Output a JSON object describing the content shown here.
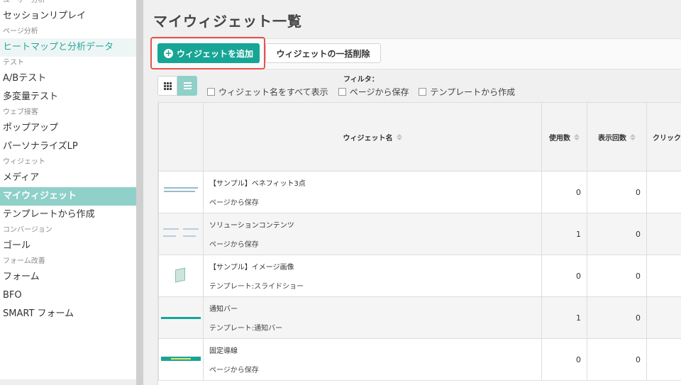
{
  "sidebar": {
    "groups": [
      {
        "heading": "ユーザー分析",
        "items": [
          {
            "label": "セッションリプレイ",
            "state": "normal"
          }
        ]
      },
      {
        "heading": "ページ分析",
        "items": [
          {
            "label": "ヒートマップと分析データ",
            "state": "highlight"
          }
        ]
      },
      {
        "heading": "テスト",
        "items": [
          {
            "label": "A/Bテスト",
            "state": "normal"
          },
          {
            "label": "多変量テスト",
            "state": "normal"
          }
        ]
      },
      {
        "heading": "ウェブ接客",
        "items": [
          {
            "label": "ポップアップ",
            "state": "normal"
          },
          {
            "label": "パーソナライズLP",
            "state": "normal"
          }
        ]
      },
      {
        "heading": "ウィジェット",
        "items": [
          {
            "label": "メディア",
            "state": "normal"
          },
          {
            "label": "マイウィジェット",
            "state": "active"
          },
          {
            "label": "テンプレートから作成",
            "state": "normal"
          }
        ]
      },
      {
        "heading": "コンバージョン",
        "items": [
          {
            "label": "ゴール",
            "state": "normal"
          }
        ]
      },
      {
        "heading": "フォーム改善",
        "items": [
          {
            "label": "フォーム",
            "state": "normal"
          },
          {
            "label": "BFO",
            "state": "normal"
          },
          {
            "label": "SMART フォーム",
            "state": "normal"
          }
        ]
      }
    ]
  },
  "page": {
    "title": "マイウィジェット一覧"
  },
  "toolbar": {
    "add_label": "ウィジェットを追加",
    "bulk_delete_label": "ウィジェットの一括削除"
  },
  "filters": {
    "label": "フィルタ：",
    "options": [
      {
        "label": "ウィジェット名をすべて表示",
        "checked": false
      },
      {
        "label": "ページから保存",
        "checked": false
      },
      {
        "label": "テンプレートから作成",
        "checked": false
      }
    ]
  },
  "table": {
    "headers": {
      "name": "ウィジェット名",
      "usage": "使用数",
      "views": "表示回数",
      "clicks": "クリック数"
    },
    "rows": [
      {
        "thumb": "text-lines",
        "name": "【サンプル】ベネフィット3点",
        "source": "ページから保存",
        "usage": "0",
        "views": "0"
      },
      {
        "thumb": "columns",
        "name": "ソリューションコンテンツ",
        "source": "ページから保存",
        "usage": "1",
        "views": "0"
      },
      {
        "thumb": "image",
        "name": "【サンプル】イメージ画像",
        "source": "テンプレート:スライドショー",
        "usage": "0",
        "views": "0"
      },
      {
        "thumb": "bar",
        "name": "通知バー",
        "source": "テンプレート:通知バー",
        "usage": "1",
        "views": "0"
      },
      {
        "thumb": "fixed",
        "name": "固定導線",
        "source": "ページから保存",
        "usage": "0",
        "views": "0"
      }
    ]
  },
  "colors": {
    "accent": "#17a596",
    "active_nav": "#8fd0c9",
    "highlight_outline": "#e8534d"
  }
}
